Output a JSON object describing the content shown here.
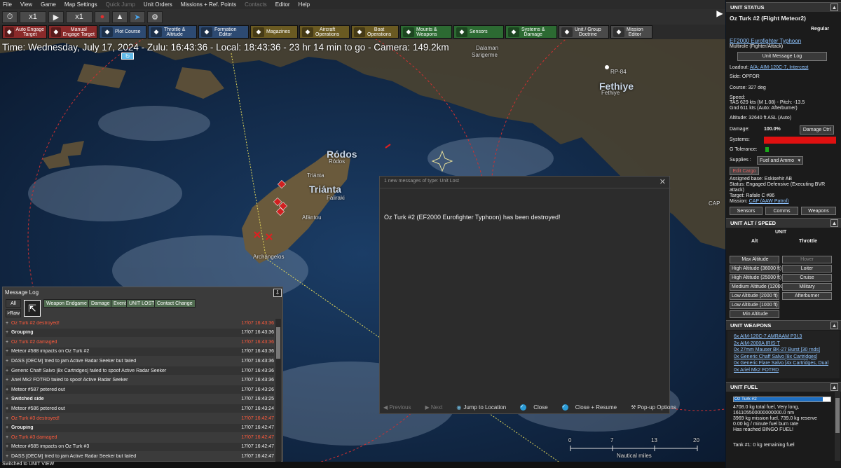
{
  "menubar": {
    "items": [
      {
        "label": "File",
        "enabled": true
      },
      {
        "label": "View",
        "enabled": true
      },
      {
        "label": "Game",
        "enabled": true
      },
      {
        "label": "Map Settings",
        "enabled": true
      },
      {
        "label": "Quick Jump",
        "enabled": false
      },
      {
        "label": "Unit Orders",
        "enabled": true
      },
      {
        "label": "Missions + Ref. Points",
        "enabled": true
      },
      {
        "label": "Contacts",
        "enabled": false
      },
      {
        "label": "Editor",
        "enabled": true
      },
      {
        "label": "Help",
        "enabled": true
      }
    ]
  },
  "timebar": {
    "speed_label": "x1",
    "speed_label2": "x1"
  },
  "toolbar2": [
    {
      "label1": "Auto Engage",
      "label2": "Target",
      "color": "#8a2a2a",
      "icon": "crosshair-icon"
    },
    {
      "label1": "Manual",
      "label2": "Engage Target",
      "color": "#8a2a2a",
      "icon": "crosshair-icon"
    },
    {
      "label1": "Plot Course",
      "label2": "",
      "color": "#2d4a72",
      "icon": "course-icon"
    },
    {
      "label1": "Throttle &",
      "label2": "Altitude",
      "color": "#2d4a72",
      "icon": "throttle-icon"
    },
    {
      "label1": "Formation",
      "label2": "Editor",
      "color": "#2d4a72",
      "icon": "formation-icon"
    },
    {
      "label1": "Magazines",
      "label2": "",
      "color": "#6a5a22",
      "icon": "magazines-icon"
    },
    {
      "label1": "Aircraft",
      "label2": "Operations",
      "color": "#6a5a22",
      "icon": "aircraft-icon"
    },
    {
      "label1": "Boat",
      "label2": "Operations",
      "color": "#6a5a22",
      "icon": "boat-icon"
    },
    {
      "label1": "Mounts &",
      "label2": "Weapons",
      "color": "#2c6a32",
      "icon": "mounts-icon"
    },
    {
      "label1": "Sensors",
      "label2": "",
      "color": "#2c6a32",
      "icon": "sensors-icon"
    },
    {
      "label1": "Systems &",
      "label2": "Damage",
      "color": "#2c6a32",
      "icon": "systems-icon"
    },
    {
      "label1": "Unit / Group",
      "label2": "Doctrine",
      "color": "#4a4a4a",
      "icon": "doctrine-icon"
    },
    {
      "label1": "Mission",
      "label2": "Editor",
      "color": "#4a4a4a",
      "icon": "mission-icon"
    }
  ],
  "map": {
    "time_text": "Time: Wednesday, July 17, 2024 - Zulu: 16:43:36 - Local: 18:43:36 - 23 hr 14 min to go - Camera: 149.2km",
    "labels": {
      "dalaman": "Dalaman",
      "sarigerme": "Sarigerme",
      "rp84": "RP-84",
      "fethiye_big": "Fethiye",
      "fethiye_small": "Fethiye",
      "rodos_big": "Ródos",
      "rodos_small": "Ródos",
      "trianta_big": "Triánta",
      "trianta_small": "Triánta",
      "faliraki": "Faliraki",
      "afantou": "Afántou",
      "archangelos": "Archángelos",
      "cap": "CAP"
    },
    "scale": {
      "ticks": [
        "0",
        "7",
        "13",
        "20"
      ],
      "unit": "Nautical miles"
    }
  },
  "message_log": {
    "title": "Message Log",
    "filters": [
      "All",
      ">Raw",
      "Weapon Endgame",
      "Damage",
      "Event",
      "UNIT LOST",
      "Contact Change"
    ],
    "rows": [
      {
        "text": "Oz Turk #2 destroyed!",
        "time": "17/07 16:43:36",
        "red": true
      },
      {
        "text": "Grouping",
        "time": "17/07 16:43:36",
        "red": false,
        "bold": true
      },
      {
        "text": "Oz Turk #2 damaged",
        "time": "17/07 16:43:36",
        "red": true
      },
      {
        "text": "Meteor #588 impacts on Oz Turk #2",
        "time": "17/07 16:43:36",
        "red": false
      },
      {
        "text": "DASS [DECM] tried to jam Active Radar Seeker but failed",
        "time": "17/07 16:43:36",
        "red": false
      },
      {
        "text": "Generic Chaff Salvo [8x Cartridges] failed to spoof Active Radar Seeker",
        "time": "17/07 16:43:36",
        "red": false
      },
      {
        "text": "Ariel Mk2 FOTRD failed to spoof Active Radar Seeker",
        "time": "17/07 16:43:36",
        "red": false
      },
      {
        "text": "Meteor #587 petered out",
        "time": "17/07 16:43:26",
        "red": false
      },
      {
        "text": "Switched side",
        "time": "17/07 16:43:25",
        "red": false,
        "bold": true
      },
      {
        "text": "Meteor #586 petered out",
        "time": "17/07 16:43:24",
        "red": false
      },
      {
        "text": "Oz Turk #3 destroyed!",
        "time": "17/07 16:42:47",
        "red": true
      },
      {
        "text": "Grouping",
        "time": "17/07 16:42:47",
        "red": false,
        "bold": true
      },
      {
        "text": "Oz Turk #3 damaged",
        "time": "17/07 16:42:47",
        "red": true
      },
      {
        "text": "Meteor #585 impacts on Oz Turk #3",
        "time": "17/07 16:42:47",
        "red": false
      },
      {
        "text": "DASS [DECM] tried to jam Active Radar Seeker but failed",
        "time": "17/07 16:42:47",
        "red": false
      }
    ]
  },
  "dialog": {
    "title": "1 new messages of type: Unit Lost",
    "message": "Oz Turk #2 (EF2000 Eurofighter Typhoon) has been destroyed!",
    "previous": "Previous",
    "next": "Next",
    "jump": "Jump to Location",
    "close": "Close",
    "close_resume": "Close + Resume",
    "popup_options": "Pop-up Options"
  },
  "unit_status": {
    "header": "UNIT STATUS",
    "name": "Oz Turk #2 (Flight Meteor2)",
    "proficiency": "Regular",
    "type_link": "EF2000 Eurofighter Typhoon",
    "role": "Multirole (Fighter/Attack)",
    "msg_log_btn": "Unit Message Log",
    "loadout_label": "Loadout:",
    "loadout_value": "A/A: AIM-120C-7, Intercept",
    "side": "Side: OPFOR",
    "course": "Course: 327 deg",
    "speed_label": "Speed:",
    "speed_line1": "TAS 629 kts (M 1.08) - Pitch: -13.5",
    "speed_line2": "Gnd 611 kts (Auto: Afterburner)",
    "altitude": "Altitude: 32640 ft ASL (Auto)",
    "damage_label": "Damage:",
    "damage_value": "100.0%",
    "damage_btn": "Damage Ctrl",
    "systems_label": "Systems:",
    "gtol_label": "G Tolerance:",
    "supplies_label": "Supplies :",
    "supplies_value": "Fuel and Ammo",
    "edit_cargo": "Edit Cargo",
    "assigned_base": "Assigned base: Eskisehir AB",
    "status_line1": "Status: Engaged Defensive (Executing BVR",
    "status_line2": "attack)",
    "target": "Target: Rafale C #86",
    "mission_label": "Mission:",
    "mission_value": "CAP (AAW Patrol)",
    "tabs": [
      "Sensors",
      "Comms",
      "Weapons"
    ],
    "colors": {
      "systems_bar": "#e01010",
      "gtol": "#1aa81a"
    }
  },
  "alt_speed": {
    "header": "UNIT ALT / SPEED",
    "sub": "UNIT",
    "alt_col": "Alt",
    "thr_col": "Throttle",
    "alt_buttons": [
      "Max Altitude",
      "High Altitude (36000 ft)",
      "High Altitude (25000 ft)",
      "Medium Altitude (12000",
      "Low Altitude (2000 ft)",
      "Low Altitude (1000 ft)",
      "Min Altitude"
    ],
    "thr_buttons": [
      "Hover",
      "Loiter",
      "Cruise",
      "Military",
      "Afterburner"
    ]
  },
  "weapons": {
    "header": "UNIT WEAPONS",
    "items": [
      "6x AIM-120C-7 AMRAAM P3I.3",
      "2x AIM-2000A IRIS-T",
      "0x 27mm Mauser BK-27 Burst [30 rnds]",
      "0x Generic Chaff Salvo [8x Cartridges]",
      "0x Generic Flare Salvo [4x Cartridges, Dual",
      "0x Ariel Mk2 FOTRD"
    ]
  },
  "fuel": {
    "header": "UNIT FUEL",
    "bar_label": "Oz Turk #2",
    "bar_fill": 0.92,
    "line1": "4708.0 kg total fuel, Very long,",
    "line2": "161105500000000000.0 nm",
    "line3": "3969 kg mission fuel, 739.0 kg reserve",
    "line4": "0.00 kg / minute fuel burn rate",
    "line5": "Has reached BINGO FUEL!",
    "line6": "Tank #1: 0 kg remaining fuel"
  },
  "statusbar": {
    "text": "Switched to UNIT VIEW"
  }
}
